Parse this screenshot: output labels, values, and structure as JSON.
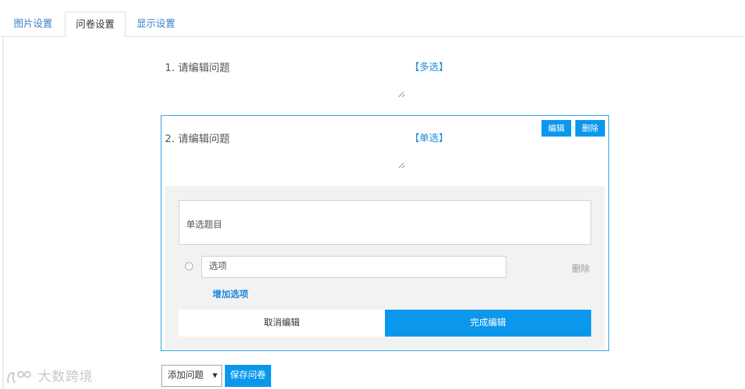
{
  "tabs": [
    {
      "label": "图片设置",
      "active": false
    },
    {
      "label": "问卷设置",
      "active": true
    },
    {
      "label": "显示设置",
      "active": false
    }
  ],
  "questions": [
    {
      "text": "1. 请编辑问题",
      "type": "【多选】"
    },
    {
      "text": "2. 请编辑问题",
      "type": "【单选】"
    }
  ],
  "question_actions": {
    "edit": "编辑",
    "delete": "删除"
  },
  "editor": {
    "title_placeholder": "单选题目",
    "option_placeholder": "选项",
    "option_delete": "删除",
    "add_option": "增加选项",
    "cancel": "取消编辑",
    "done": "完成编辑"
  },
  "footer": {
    "add_question": "添加问题",
    "save": "保存问卷"
  },
  "watermark": "大数跨境",
  "colors": {
    "accent": "#0b98ec",
    "link": "#1a8ad8",
    "border": "#1a9be6"
  }
}
